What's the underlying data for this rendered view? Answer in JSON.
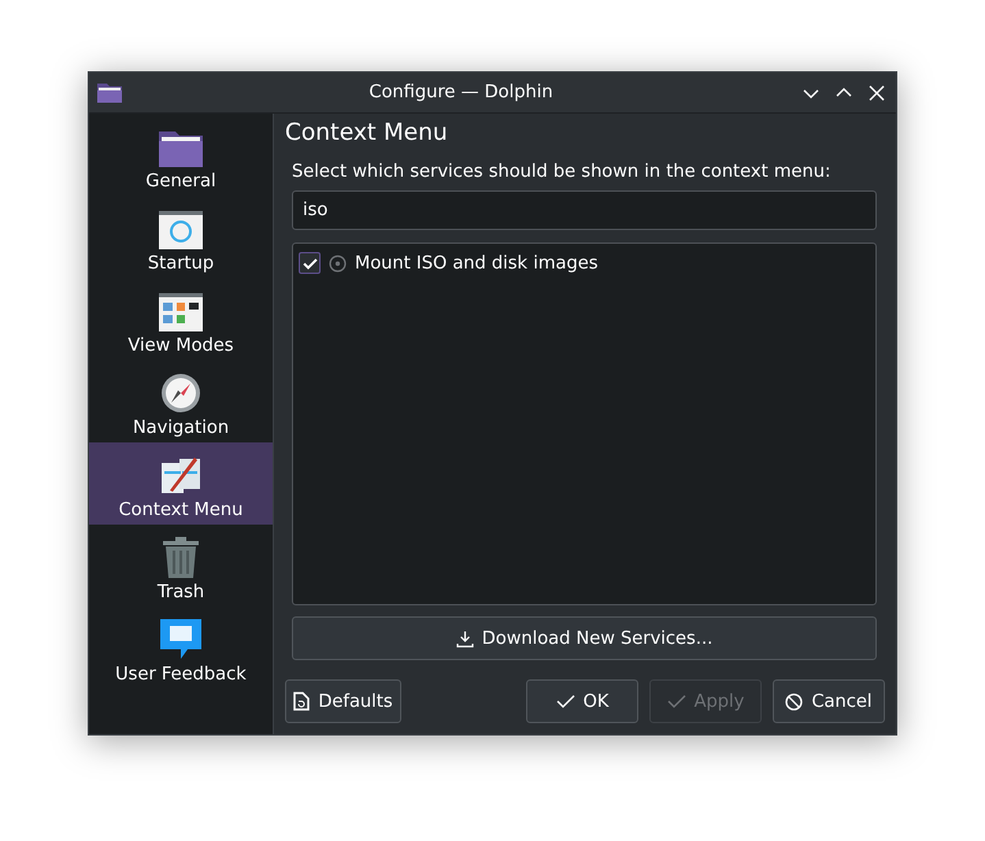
{
  "window": {
    "title": "Configure — Dolphin"
  },
  "sidebar": {
    "items": [
      {
        "label": "General",
        "selected": false
      },
      {
        "label": "Startup",
        "selected": false
      },
      {
        "label": "View Modes",
        "selected": false
      },
      {
        "label": "Navigation",
        "selected": false
      },
      {
        "label": "Context Menu",
        "selected": true
      },
      {
        "label": "Trash",
        "selected": false
      },
      {
        "label": "User Feedback",
        "selected": false
      }
    ]
  },
  "page": {
    "title": "Context Menu",
    "instruction": "Select which services should be shown in the context menu:",
    "search": {
      "value": "iso"
    },
    "services": [
      {
        "label": "Mount ISO and disk images",
        "checked": true
      }
    ],
    "download_button": "Download New Services..."
  },
  "buttons": [
    {
      "kind": "defaults",
      "label": "Defaults",
      "disabled": false
    },
    {
      "kind": "ok",
      "label": "OK",
      "disabled": false
    },
    {
      "kind": "apply",
      "label": "Apply",
      "disabled": true
    },
    {
      "kind": "cancel",
      "label": "Cancel",
      "disabled": false
    }
  ]
}
